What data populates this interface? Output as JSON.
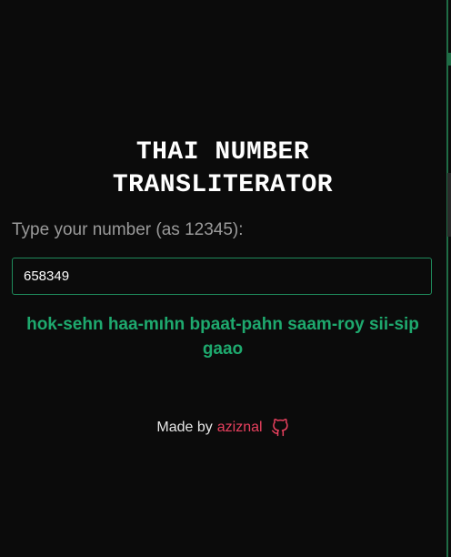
{
  "app": {
    "title_line1": "THAI NUMBER",
    "title_line2": "TRANSLITERATOR"
  },
  "form": {
    "label": "Type your number (as 12345):",
    "input_value": "658349"
  },
  "result": {
    "line1": "hok-sehn haa-mıhn bpaat-pahn saam-roy sii-sip",
    "line2": "gaao"
  },
  "footer": {
    "prefix": "Made by",
    "author": "aziznal",
    "icon": "github-icon"
  },
  "colors": {
    "background": "#0b0b0b",
    "accent_green": "#1ea96e",
    "border_green": "#1f8a5b",
    "link_red": "#e8405e"
  }
}
